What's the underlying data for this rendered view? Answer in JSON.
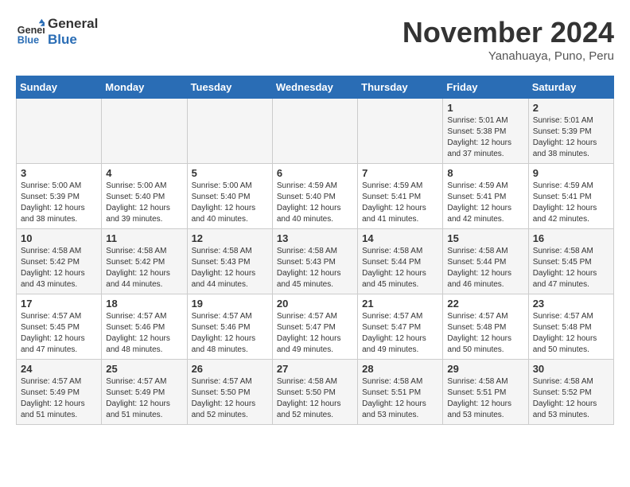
{
  "logo": {
    "line1": "General",
    "line2": "Blue"
  },
  "title": "November 2024",
  "subtitle": "Yanahuaya, Puno, Peru",
  "days_of_week": [
    "Sunday",
    "Monday",
    "Tuesday",
    "Wednesday",
    "Thursday",
    "Friday",
    "Saturday"
  ],
  "weeks": [
    [
      {
        "day": "",
        "info": ""
      },
      {
        "day": "",
        "info": ""
      },
      {
        "day": "",
        "info": ""
      },
      {
        "day": "",
        "info": ""
      },
      {
        "day": "",
        "info": ""
      },
      {
        "day": "1",
        "info": "Sunrise: 5:01 AM\nSunset: 5:38 PM\nDaylight: 12 hours and 37 minutes."
      },
      {
        "day": "2",
        "info": "Sunrise: 5:01 AM\nSunset: 5:39 PM\nDaylight: 12 hours and 38 minutes."
      }
    ],
    [
      {
        "day": "3",
        "info": "Sunrise: 5:00 AM\nSunset: 5:39 PM\nDaylight: 12 hours and 38 minutes."
      },
      {
        "day": "4",
        "info": "Sunrise: 5:00 AM\nSunset: 5:40 PM\nDaylight: 12 hours and 39 minutes."
      },
      {
        "day": "5",
        "info": "Sunrise: 5:00 AM\nSunset: 5:40 PM\nDaylight: 12 hours and 40 minutes."
      },
      {
        "day": "6",
        "info": "Sunrise: 4:59 AM\nSunset: 5:40 PM\nDaylight: 12 hours and 40 minutes."
      },
      {
        "day": "7",
        "info": "Sunrise: 4:59 AM\nSunset: 5:41 PM\nDaylight: 12 hours and 41 minutes."
      },
      {
        "day": "8",
        "info": "Sunrise: 4:59 AM\nSunset: 5:41 PM\nDaylight: 12 hours and 42 minutes."
      },
      {
        "day": "9",
        "info": "Sunrise: 4:59 AM\nSunset: 5:41 PM\nDaylight: 12 hours and 42 minutes."
      }
    ],
    [
      {
        "day": "10",
        "info": "Sunrise: 4:58 AM\nSunset: 5:42 PM\nDaylight: 12 hours and 43 minutes."
      },
      {
        "day": "11",
        "info": "Sunrise: 4:58 AM\nSunset: 5:42 PM\nDaylight: 12 hours and 44 minutes."
      },
      {
        "day": "12",
        "info": "Sunrise: 4:58 AM\nSunset: 5:43 PM\nDaylight: 12 hours and 44 minutes."
      },
      {
        "day": "13",
        "info": "Sunrise: 4:58 AM\nSunset: 5:43 PM\nDaylight: 12 hours and 45 minutes."
      },
      {
        "day": "14",
        "info": "Sunrise: 4:58 AM\nSunset: 5:44 PM\nDaylight: 12 hours and 45 minutes."
      },
      {
        "day": "15",
        "info": "Sunrise: 4:58 AM\nSunset: 5:44 PM\nDaylight: 12 hours and 46 minutes."
      },
      {
        "day": "16",
        "info": "Sunrise: 4:58 AM\nSunset: 5:45 PM\nDaylight: 12 hours and 47 minutes."
      }
    ],
    [
      {
        "day": "17",
        "info": "Sunrise: 4:57 AM\nSunset: 5:45 PM\nDaylight: 12 hours and 47 minutes."
      },
      {
        "day": "18",
        "info": "Sunrise: 4:57 AM\nSunset: 5:46 PM\nDaylight: 12 hours and 48 minutes."
      },
      {
        "day": "19",
        "info": "Sunrise: 4:57 AM\nSunset: 5:46 PM\nDaylight: 12 hours and 48 minutes."
      },
      {
        "day": "20",
        "info": "Sunrise: 4:57 AM\nSunset: 5:47 PM\nDaylight: 12 hours and 49 minutes."
      },
      {
        "day": "21",
        "info": "Sunrise: 4:57 AM\nSunset: 5:47 PM\nDaylight: 12 hours and 49 minutes."
      },
      {
        "day": "22",
        "info": "Sunrise: 4:57 AM\nSunset: 5:48 PM\nDaylight: 12 hours and 50 minutes."
      },
      {
        "day": "23",
        "info": "Sunrise: 4:57 AM\nSunset: 5:48 PM\nDaylight: 12 hours and 50 minutes."
      }
    ],
    [
      {
        "day": "24",
        "info": "Sunrise: 4:57 AM\nSunset: 5:49 PM\nDaylight: 12 hours and 51 minutes."
      },
      {
        "day": "25",
        "info": "Sunrise: 4:57 AM\nSunset: 5:49 PM\nDaylight: 12 hours and 51 minutes."
      },
      {
        "day": "26",
        "info": "Sunrise: 4:57 AM\nSunset: 5:50 PM\nDaylight: 12 hours and 52 minutes."
      },
      {
        "day": "27",
        "info": "Sunrise: 4:58 AM\nSunset: 5:50 PM\nDaylight: 12 hours and 52 minutes."
      },
      {
        "day": "28",
        "info": "Sunrise: 4:58 AM\nSunset: 5:51 PM\nDaylight: 12 hours and 53 minutes."
      },
      {
        "day": "29",
        "info": "Sunrise: 4:58 AM\nSunset: 5:51 PM\nDaylight: 12 hours and 53 minutes."
      },
      {
        "day": "30",
        "info": "Sunrise: 4:58 AM\nSunset: 5:52 PM\nDaylight: 12 hours and 53 minutes."
      }
    ]
  ]
}
